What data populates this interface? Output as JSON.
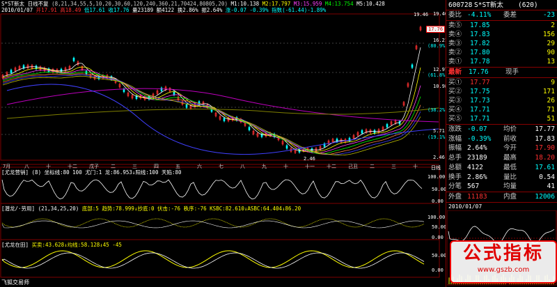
{
  "colors": {
    "up": "#ff3030",
    "down": "#00ffff",
    "yellow": "#ffff00",
    "white": "#ffffff",
    "grid": "#800000",
    "bg": "#000000"
  },
  "header": {
    "name": "S*ST新太",
    "style": "日线不复",
    "ma_params": "(8,21,34,55,5,10,20,30,60,120,240,360,21,70424,80805,20)",
    "m1": "M1:10.138",
    "m2": "M2:17.797",
    "m3": "M3:15.959",
    "m4": "M4:13.754",
    "m5": "M5:10.428",
    "ma_more": "MA6:… MA7:6.597 MA8:6.412 ——"
  },
  "header2": {
    "date": "2010/01/07",
    "open": "开17.91",
    "high": "高18.49",
    "low": "低17.61",
    "close": "收17.76",
    "vol": "量23189",
    "amount": "额4122",
    "turnover": "换2.86%",
    "amplitude": "振2.64%",
    "change": "涨-0.07",
    "pct": "-0.39%",
    "index": "指数(-61.44)-1.89%"
  },
  "price_axis": [
    {
      "v": "19.46",
      "c": "#ffffff"
    },
    {
      "v": "16.21",
      "c": "#ffffff"
    },
    {
      "v": "(80.9%)",
      "c": "#00ffff"
    },
    {
      "v": "12.97",
      "c": "#ffffff"
    },
    {
      "v": "(61.8%)",
      "c": "#00ffff"
    },
    {
      "v": "10.98",
      "c": "#ffffff"
    },
    {
      "v": "(38.2%)",
      "c": "#00ffff"
    },
    {
      "v": "5.71",
      "c": "#ffffff"
    },
    {
      "v": "(19.1%)",
      "c": "#00ffff"
    },
    {
      "v": "2.46",
      "c": "#ffffff"
    }
  ],
  "current_price_tag": "17.76",
  "high_marker": "19.46",
  "low_marker": "2.46",
  "month_axis": [
    "7月",
    "八",
    "十",
    "十二",
    "戊子",
    "二",
    "三",
    "四",
    "五",
    "六",
    "七",
    "八",
    "九",
    "十",
    "十一",
    "十二",
    "己丑",
    "二",
    "三",
    "十"
  ],
  "day_line_label": "日线",
  "ind1": {
    "title": "[尤龙营销] (8) 坐标线:80 100",
    "legend": "尤门:1 龙:86.953↓阳线:100 天陷:80",
    "axis": [
      "100.00",
      "50.00",
      "0.00"
    ]
  },
  "ind2": {
    "title": "[潜龙/·劳用] (21,34,25,20)",
    "legend": "底部:5 趋势:78.999↓抄底:0 伏击:-76 秩序:-76 KSBC:82.610↓ASBC:64.404↓86.20",
    "axis": [
      "100.00",
      "50.00",
      "0.00"
    ]
  },
  "ind3": {
    "title": "[尤龙在田]",
    "legend": "买卖:43.628↓均线:58.128↓45 -45",
    "axis": [
      "50.00",
      "0.00"
    ]
  },
  "footer": "飞狐交易师",
  "quote": {
    "code": "600728",
    "name": "S*ST新太",
    "count": "(620)",
    "weibi_label": "委比",
    "weibi": "-4.11%",
    "weicha_label": "委差",
    "weicha": "-23",
    "asks": [
      {
        "label": "卖⑤",
        "price": "17.85",
        "vol": "2"
      },
      {
        "label": "卖④",
        "price": "17.83",
        "vol": "156"
      },
      {
        "label": "卖③",
        "price": "17.82",
        "vol": "29"
      },
      {
        "label": "卖②",
        "price": "17.80",
        "vol": "90"
      },
      {
        "label": "卖①",
        "price": "17.78",
        "vol": "13"
      }
    ],
    "latest_label": "最新",
    "latest": "17.76",
    "xianshou_label": "现手",
    "bids": [
      {
        "label": "买①",
        "price": "17.77",
        "vol": "9"
      },
      {
        "label": "买②",
        "price": "17.75",
        "vol": "171"
      },
      {
        "label": "买③",
        "price": "17.73",
        "vod": "",
        "vol": "26"
      },
      {
        "label": "买④",
        "price": "17.71",
        "vol": "71"
      },
      {
        "label": "买⑤",
        "price": "17.71",
        "vol": "51"
      }
    ],
    "stats": [
      {
        "l1": "涨跌",
        "v1": "-0.07",
        "l2": "均价",
        "v2": "17.77",
        "c1": "#00ffff",
        "c2": "#ffffff"
      },
      {
        "l1": "涨幅",
        "v1": "-0.39%",
        "l2": "前收",
        "v2": "17.83",
        "c1": "#00ffff",
        "c2": "#ffffff"
      },
      {
        "l1": "振幅",
        "v1": "2.64%",
        "l2": "今开",
        "v2": "17.90",
        "c1": "#ffffff",
        "c2": "#ff3030"
      },
      {
        "l1": "总手",
        "v1": "23189",
        "l2": "最高",
        "v2": "18.20",
        "c1": "#ffffff",
        "c2": "#ff3030"
      },
      {
        "l1": "总额",
        "v1": "4122",
        "l2": "最低",
        "v2": "17.61",
        "c1": "#ffffff",
        "c2": "#00ffff"
      },
      {
        "l1": "换手",
        "v1": "2.86%",
        "l2": "量比",
        "v2": "0.54",
        "c1": "#ffffff",
        "c2": "#ffffff"
      },
      {
        "l1": "分笔",
        "v1": "567",
        "l2": "均量",
        "v2": "41",
        "c1": "#ffffff",
        "c2": "#ffffff"
      }
    ],
    "outer_label": "外盘",
    "outer": "11183",
    "inner_label": "内盘",
    "inner": "12006",
    "mini_date": "2010/01/07"
  },
  "watermark": {
    "main": "公式指标",
    "url": "www.gszb.com"
  }
}
